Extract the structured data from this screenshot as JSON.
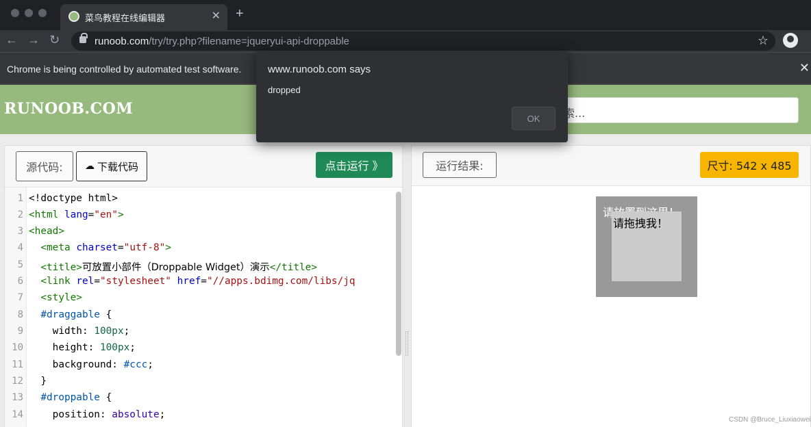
{
  "browser": {
    "tab_title": "菜鸟教程在线编辑器",
    "tab_close": "✕",
    "new_tab": "+",
    "url_host": "runoob.com",
    "url_path": "/try/try.php?filename=jqueryui-api-droppable",
    "back": "←",
    "forward": "→",
    "reload": "↻",
    "star": "☆"
  },
  "infobar": {
    "text": "Chrome is being controlled by automated test software.",
    "close": "✕"
  },
  "site": {
    "logo": "RUNOOB.COM",
    "search_placeholder": "索..."
  },
  "editor": {
    "source_label": "源代码:",
    "download_label": "下载代码",
    "run_label": "点击运行 》",
    "line_numbers": [
      "1",
      "2",
      "3",
      "4",
      "5",
      "6",
      "7",
      "8",
      "9",
      "10",
      "11",
      "12",
      "13",
      "14"
    ],
    "code": {
      "l1": "<!doctype html>",
      "l2_open": "<html",
      "l2_attr": "lang",
      "l2_val": "\"en\"",
      "l2_close": ">",
      "l3": "<head>",
      "l4_open": "<meta",
      "l4_attr": "charset",
      "l4_val": "\"utf-8\"",
      "l4_close": ">",
      "l5_open": "<title>",
      "l5_text": "可放置小部件（Droppable Widget）演示",
      "l5_close": "</title>",
      "l6_open": "<link",
      "l6_attr1": "rel",
      "l6_val1": "\"stylesheet\"",
      "l6_attr2": "href",
      "l6_val2": "\"//apps.bdimg.com/libs/jq",
      "l7": "<style>",
      "l8_sel": "#draggable",
      "l8_brace": " {",
      "l9_prop": "width: ",
      "l9_val": "100px",
      "l9_end": ";",
      "l10_prop": "height: ",
      "l10_val": "100px",
      "l10_end": ";",
      "l11_prop": "background: ",
      "l11_val": "#ccc",
      "l11_end": ";",
      "l12": "}",
      "l13_sel": "#droppable",
      "l13_brace": " {",
      "l14_prop": "position: ",
      "l14_val": "absolute",
      "l14_end": ";"
    }
  },
  "result": {
    "label": "运行结果:",
    "size": "尺寸: 542 x 485",
    "droppable_text": "请放置到这里！",
    "draggable_text": "请拖拽我！"
  },
  "dialog": {
    "title": "www.runoob.com says",
    "message": "dropped",
    "ok": "OK"
  },
  "watermark": "CSDN @Bruce_Liuxiaowei",
  "colors": {
    "header_green": "#96b97d",
    "run_green": "#1f8a55",
    "size_yellow": "#f7b500",
    "chrome_dark": "#35363a"
  }
}
